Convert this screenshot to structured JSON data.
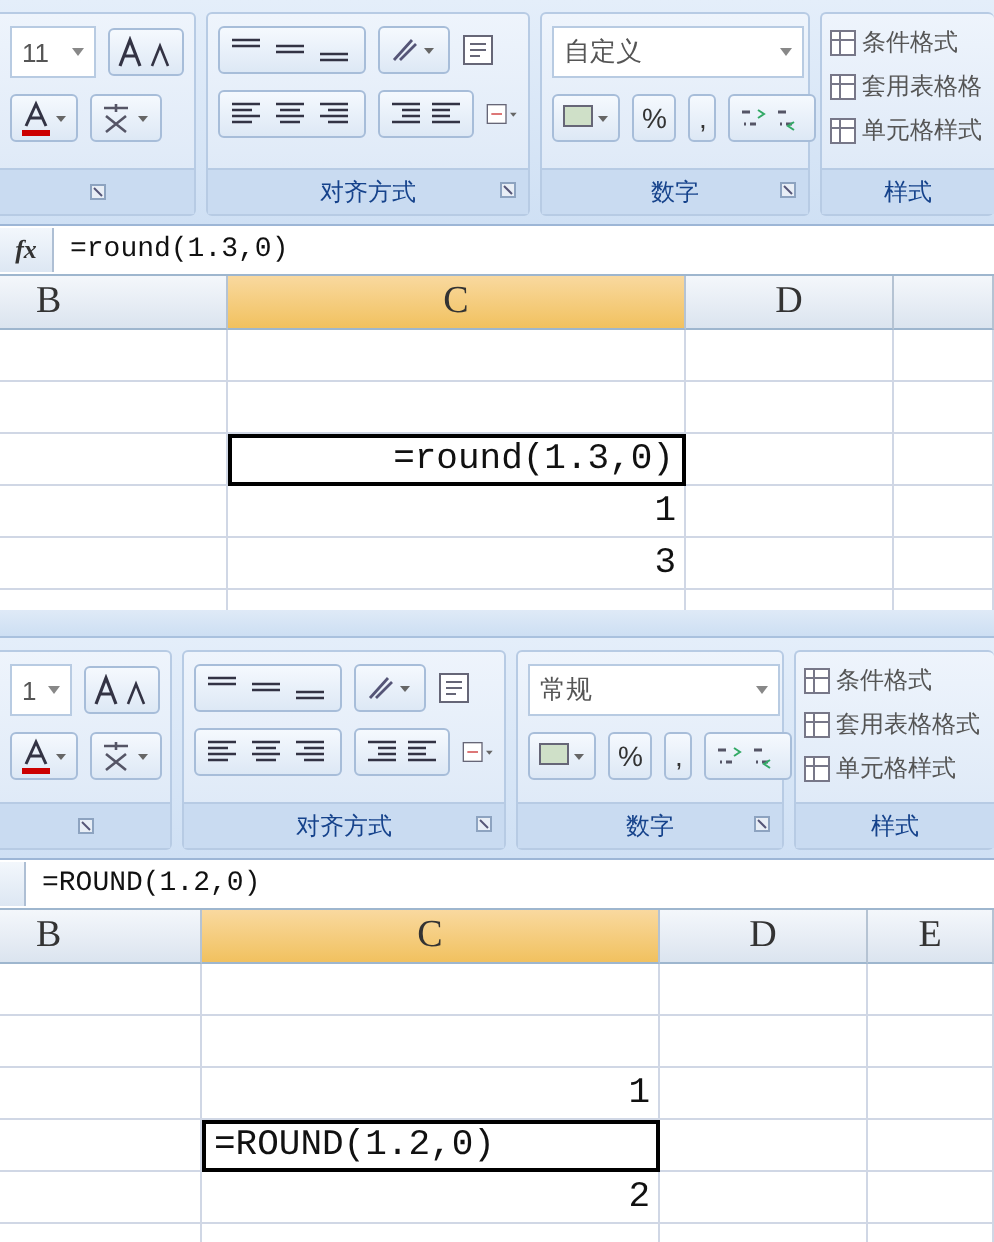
{
  "panels": [
    {
      "ribbon": {
        "font_size": "11",
        "groups": [
          {
            "label": "对齐方式"
          },
          {
            "label": "数字"
          },
          {
            "label": "样式"
          }
        ],
        "number_format": "自定义",
        "percent": "%",
        "comma": ",",
        "style_items": [
          "条件格式",
          "套用表格格",
          "单元格样式"
        ]
      },
      "formula_bar": {
        "fx": "fx",
        "formula": "=round(1.3,0)"
      },
      "columns": [
        {
          "label": "B",
          "selected": false
        },
        {
          "label": "C",
          "selected": true
        },
        {
          "label": "D",
          "selected": false
        }
      ],
      "rows": [
        {
          "c_value": "",
          "selected": false
        },
        {
          "c_value": "",
          "selected": false
        },
        {
          "c_value": "=round(1.3,0)",
          "selected": true,
          "right_aligned": true
        },
        {
          "c_value": "1",
          "selected": false,
          "right_aligned": true
        },
        {
          "c_value": "3",
          "selected": false,
          "right_aligned": true
        },
        {
          "c_value": "",
          "selected": false
        }
      ]
    },
    {
      "ribbon": {
        "font_size": "1",
        "groups": [
          {
            "label": "对齐方式"
          },
          {
            "label": "数字"
          },
          {
            "label": "样式"
          }
        ],
        "number_format": "常规",
        "percent": "%",
        "comma": ",",
        "style_items": [
          "条件格式",
          "套用表格格式",
          "单元格样式"
        ]
      },
      "formula_bar": {
        "formula": "=ROUND(1.2,0)"
      },
      "columns": [
        {
          "label": "B",
          "selected": false
        },
        {
          "label": "C",
          "selected": true
        },
        {
          "label": "D",
          "selected": false
        },
        {
          "label": "E",
          "selected": false
        }
      ],
      "rows": [
        {
          "c_value": "",
          "selected": false
        },
        {
          "c_value": "",
          "selected": false
        },
        {
          "c_value": "1",
          "selected": false,
          "right_aligned": true
        },
        {
          "c_value": "=ROUND(1.2,0)",
          "selected": true,
          "right_aligned": false
        },
        {
          "c_value": "2",
          "selected": false,
          "right_aligned": true
        },
        {
          "c_value": "",
          "selected": false
        }
      ]
    }
  ]
}
